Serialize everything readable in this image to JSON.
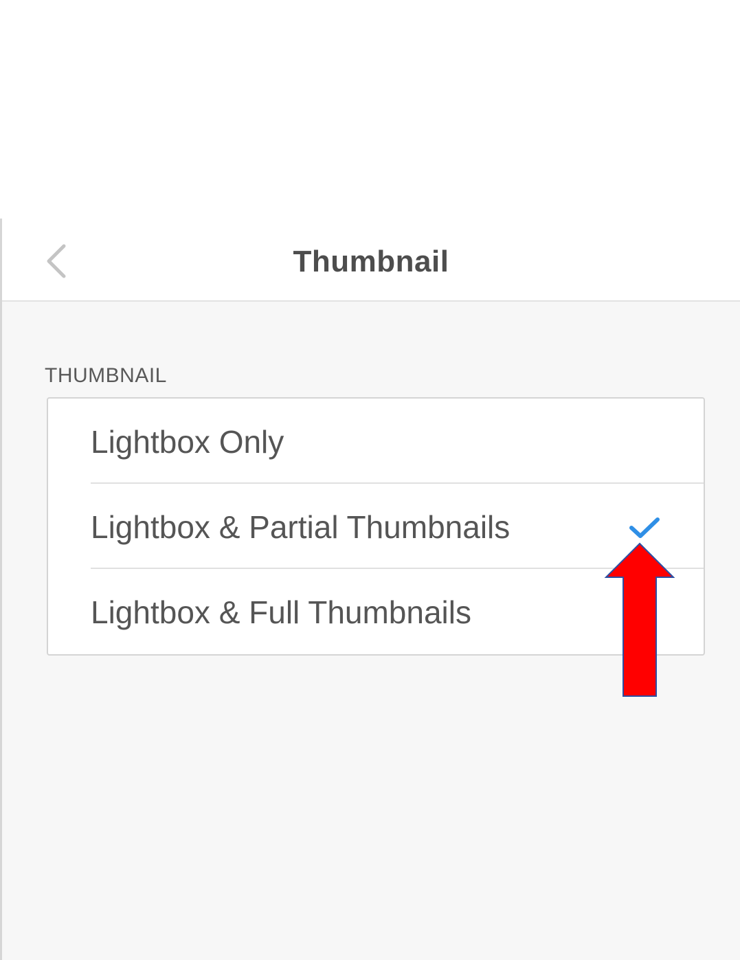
{
  "header": {
    "title": "Thumbnail",
    "back_icon": "chevron-left-icon"
  },
  "section": {
    "label": "THUMBNAIL"
  },
  "options": [
    {
      "label": "Lightbox Only",
      "selected": false
    },
    {
      "label": "Lightbox & Partial Thumbnails",
      "selected": true
    },
    {
      "label": "Lightbox & Full Thumbnails",
      "selected": false
    }
  ],
  "colors": {
    "check": "#2f8fe6",
    "arrow_fill": "#ff0000",
    "arrow_stroke": "#2b4fa3"
  },
  "annotation": {
    "icon": "red-up-arrow-icon"
  }
}
